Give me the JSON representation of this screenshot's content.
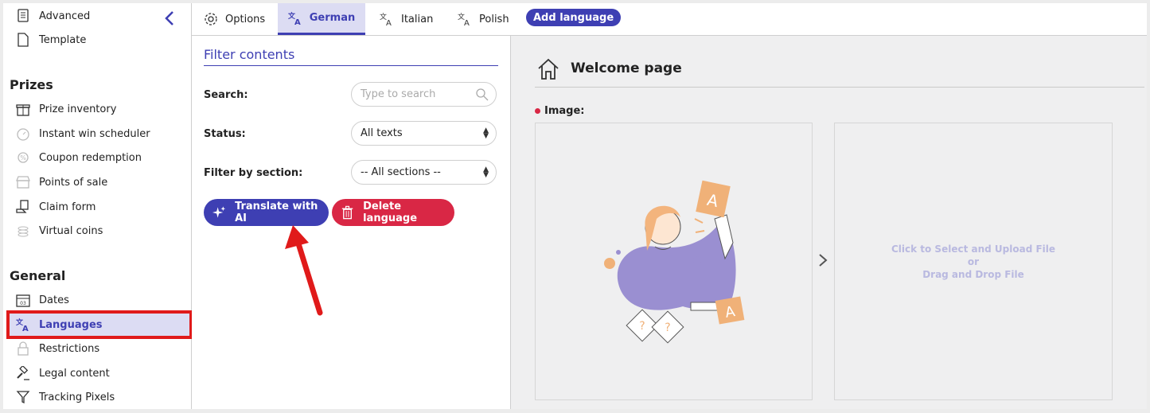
{
  "sidebar": {
    "top_items": [
      {
        "label": "Advanced",
        "icon": "advanced-icon"
      },
      {
        "label": "Template",
        "icon": "template-icon"
      }
    ],
    "prizes_heading": "Prizes",
    "prizes_items": [
      {
        "label": "Prize inventory",
        "icon": "gift-icon"
      },
      {
        "label": "Instant win scheduler",
        "icon": "timer-icon"
      },
      {
        "label": "Coupon redemption",
        "icon": "coupon-icon"
      },
      {
        "label": "Points of sale",
        "icon": "store-icon"
      },
      {
        "label": "Claim form",
        "icon": "claim-icon"
      },
      {
        "label": "Virtual coins",
        "icon": "coins-icon"
      }
    ],
    "general_heading": "General",
    "general_items": [
      {
        "label": "Dates",
        "icon": "calendar-icon"
      },
      {
        "label": "Languages",
        "icon": "translate-icon"
      },
      {
        "label": "Restrictions",
        "icon": "lock-icon"
      },
      {
        "label": "Legal content",
        "icon": "gavel-icon"
      },
      {
        "label": "Tracking Pixels",
        "icon": "filter-funnel-icon"
      }
    ],
    "active_item": "Languages"
  },
  "tabs": [
    {
      "label": "Options",
      "icon": "gear-icon"
    },
    {
      "label": "German",
      "icon": "translate-icon",
      "active": true
    },
    {
      "label": "Italian",
      "icon": "translate-icon"
    },
    {
      "label": "Polish",
      "icon": "translate-icon"
    }
  ],
  "add_language_label": "Add language",
  "filter": {
    "title": "Filter contents",
    "search_label": "Search:",
    "search_placeholder": "Type to search",
    "status_label": "Status:",
    "status_value": "All texts",
    "section_label": "Filter by section:",
    "section_value": "-- All sections --",
    "translate_button": "Translate with AI",
    "delete_button": "Delete language"
  },
  "content": {
    "page_title": "Welcome page",
    "image_label": "Image:",
    "upload_line1": "Click to Select and Upload File",
    "upload_line2": "or",
    "upload_line3": "Drag and Drop File"
  },
  "colors": {
    "accent": "#3e3fb3",
    "danger": "#d92745",
    "highlight": "#e01a1a",
    "active_bg": "#dcdcf3"
  }
}
